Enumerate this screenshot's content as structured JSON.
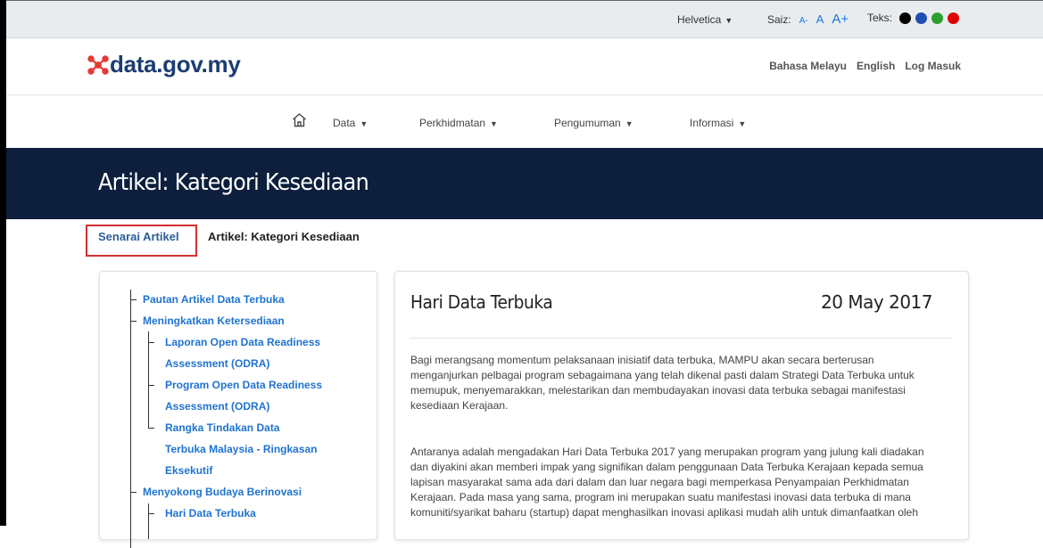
{
  "utility": {
    "font_label": "Helvetica",
    "size_label": "Saiz:",
    "size_small": "A-",
    "size_normal": "A",
    "size_large": "A+",
    "text_label": "Teks:",
    "text_colors": [
      "#000000",
      "#1f4fb0",
      "#2ca02c",
      "#e00000"
    ]
  },
  "header": {
    "logo_text": "data.gov.my",
    "links": [
      "Bahasa Melayu",
      "English",
      "Log Masuk"
    ]
  },
  "nav": {
    "home_icon": "home-icon",
    "items": [
      "Data",
      "Perkhidmatan",
      "Pengumuman",
      "Informasi"
    ]
  },
  "banner": {
    "title": "Artikel: Kategori Kesediaan"
  },
  "breadcrumb": {
    "items": [
      "Senarai Artikel",
      "Artikel: Kategori Kesediaan"
    ],
    "highlight_color": "#d32f2f"
  },
  "sidebar": {
    "lines": [
      "Pautan Artikel Data Terbuka",
      "Meningkatkan Ketersediaan",
      "Laporan Open Data Readiness",
      "Assessment (ODRA)",
      "Program Open Data Readiness",
      "Assessment (ODRA)",
      "Rangka Tindakan Data",
      "Terbuka Malaysia - Ringkasan",
      "Eksekutif",
      "Menyokong Budaya Berinovasi",
      "Hari Data Terbuka"
    ]
  },
  "article": {
    "title": "Hari Data Terbuka",
    "date": "20 May 2017",
    "paragraph1_lines": [
      "Bagi merangsang momentum pelaksanaan inisiatif data terbuka,   MAMPU akan secara berterusan",
      "menganjurkan pelbagai program sebagaimana yang telah dikenal pasti dalam Strategi Data Terbuka untuk",
      "memupuk, menyemarakkan, melestarikan dan membudayakan inovasi data terbuka sebagai manifestasi",
      "kesediaan Kerajaan."
    ],
    "paragraph2_lines": [
      "Antaranya adalah mengadakan Hari Data Terbuka 2017 yang merupakan program yang julung kali diadakan",
      "dan diyakini akan memberi impak yang signifikan dalam penggunaan Data Terbuka Kerajaan kepada semua",
      "lapisan masyarakat sama ada dari dalam dan luar negara bagi memperkasa Penyampaian Perkhidmatan",
      "Kerajaan. Pada masa yang sama, program ini merupakan suatu manifestasi inovasi data terbuka di mana",
      "komuniti/syarikat baharu (startup) dapat menghasilkan inovasi aplikasi mudah alih untuk dimanfaatkan oleh"
    ]
  },
  "colors": {
    "banner_bg": "#0d1f3c",
    "link": "#1f73d1",
    "logo": "#1c3d73",
    "logo_mark": "#e53935"
  }
}
